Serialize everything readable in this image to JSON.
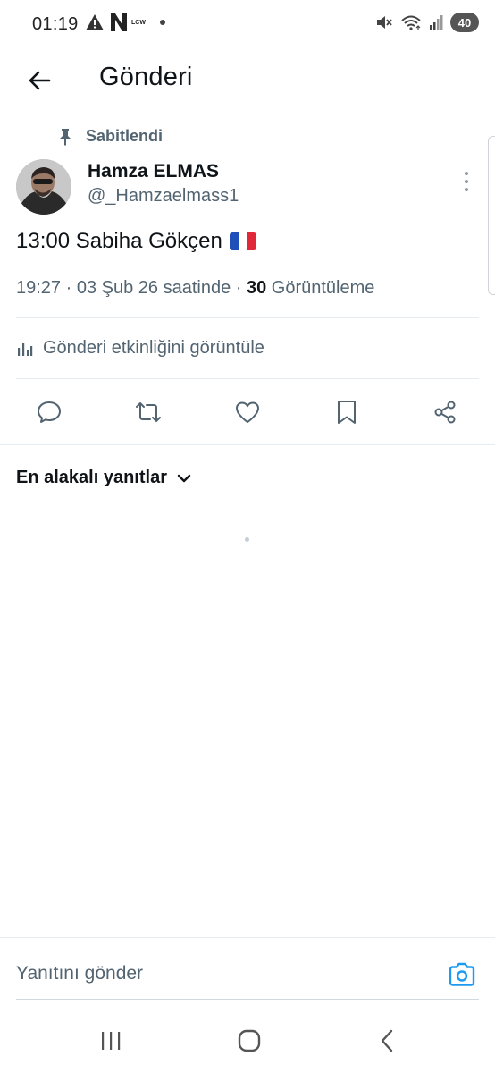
{
  "status_bar": {
    "time": "01:19",
    "carrier_badge": "LCW",
    "battery": "40",
    "icons": [
      "warning-icon",
      "n-app-icon",
      "dot-icon",
      "mute-icon",
      "wifi-icon",
      "signal-icon",
      "battery-icon"
    ]
  },
  "header": {
    "title": "Gönderi",
    "back_icon": "arrow-left-icon"
  },
  "post": {
    "pinned_label": "Sabitlendi",
    "author_name": "Hamza ELMAS",
    "author_handle": "@_Hamzaelmass1",
    "text": "13:00 Sabiha Gökçen",
    "emoji": "french-flag",
    "timestamp": "19:27 · 03 Şub 26 saatinde · ",
    "views_count": "30",
    "views_label": " Görüntüleme",
    "activity_label": "Gönderi etkinliğini görüntüle"
  },
  "actions": [
    {
      "name": "reply",
      "icon": "comment-icon"
    },
    {
      "name": "repost",
      "icon": "repost-icon"
    },
    {
      "name": "like",
      "icon": "heart-icon"
    },
    {
      "name": "bookmark",
      "icon": "bookmark-icon"
    },
    {
      "name": "share",
      "icon": "share-icon"
    }
  ],
  "replies": {
    "sort_label": "En alakalı yanıtlar"
  },
  "reply_bar": {
    "placeholder": "Yanıtını gönder"
  },
  "colors": {
    "text_primary": "#0f1419",
    "text_secondary": "#536471",
    "accent": "#1d9bf0",
    "divider": "#e6ecf0"
  }
}
